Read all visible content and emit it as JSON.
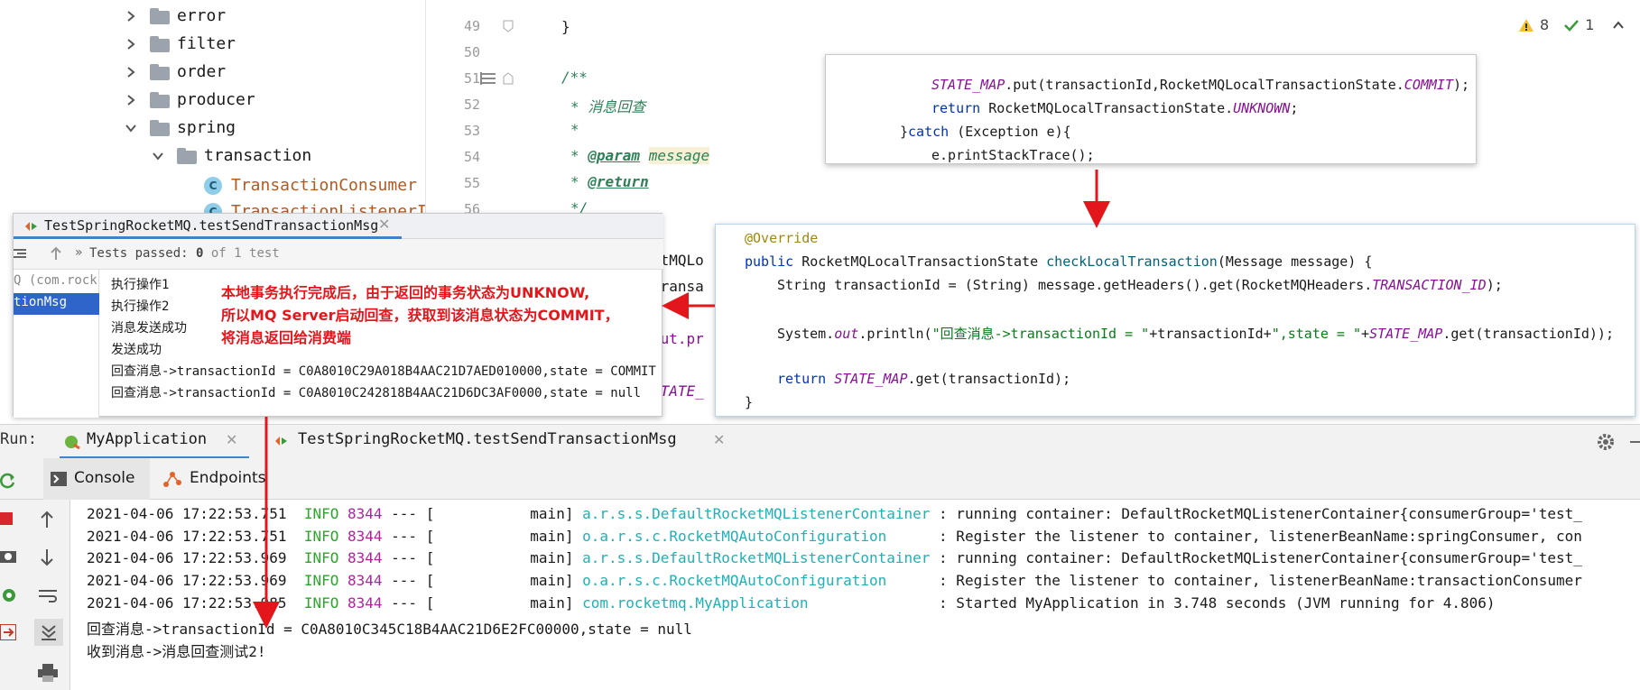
{
  "project_tree": {
    "items": [
      {
        "label": "error",
        "kind": "folder",
        "expanded": false
      },
      {
        "label": "filter",
        "kind": "folder",
        "expanded": false
      },
      {
        "label": "order",
        "kind": "folder",
        "expanded": false
      },
      {
        "label": "producer",
        "kind": "folder",
        "expanded": false
      },
      {
        "label": "spring",
        "kind": "folder",
        "expanded": true
      },
      {
        "label": "transaction",
        "kind": "folder",
        "expanded": true
      },
      {
        "label": "TransactionConsumer",
        "kind": "class"
      },
      {
        "label": "TransactionListenerI",
        "kind": "class"
      }
    ]
  },
  "editor": {
    "line_numbers": [
      "49",
      "50",
      "51",
      "52",
      "53",
      "54",
      "55",
      "56"
    ],
    "lines": {
      "l49": "}",
      "l51": "/**",
      "l52_star": "* ",
      "l52_text": "消息回查",
      "l53": "*",
      "l54_star": "* ",
      "l54_tag": "@param",
      "l54_param": "message",
      "l55_star": "* ",
      "l55_tag": "@return",
      "l56": "*/"
    },
    "peek_lines": [
      "etMQLo",
      "transa",
      "out.pr",
      "STATE_"
    ],
    "inspections": {
      "warnings": "8",
      "ok": "1"
    }
  },
  "popup_top": {
    "line1_const": "STATE_MAP",
    "line1_rest": ".put(transactionId,RocketMQLocalTransactionState.",
    "line1_commit": "COMMIT",
    "line1_end": ");",
    "line2_kw": "return",
    "line2_rest": " RocketMQLocalTransactionState.",
    "line2_unknown": "UNKNOWN",
    "line2_end": ";",
    "line3_open": "}",
    "line3_kw": "catch",
    "line3_rest": " (Exception e){",
    "line4": "e.printStackTrace();"
  },
  "popup_method": {
    "annotation": "@Override",
    "sig_kw": "public",
    "sig_type": " RocketMQLocalTransactionState ",
    "sig_name": "checkLocalTransaction",
    "sig_rest": "(Message message) {",
    "line2_pre": "String transactionId = (String) message.getHeaders().get(RocketMQHeaders.",
    "line2_const": "TRANSACTION_ID",
    "line2_end": ");",
    "line3_pre": "System.",
    "line3_out": "out",
    "line3_mid": ".println(",
    "line3_str1": "\"回查消息->transactionId = \"",
    "line3_mid2": "+transactionId+",
    "line3_str2": "\",state = \"",
    "line3_plus": "+",
    "line3_const": "STATE_MAP",
    "line3_end": ".get(transactionId));",
    "line4_kw": "return",
    "line4_const": "STATE_MAP",
    "line4_end": ".get(transactionId);",
    "close": "}"
  },
  "test_popup": {
    "tab_title": "TestSpringRocketMQ.testSendTransactionMsg",
    "tests_passed_label": "Tests passed: ",
    "tests_passed_count": "0",
    "tests_passed_suffix": " of 1 test",
    "left_items": [
      "Q (com.rock",
      "tionMsg"
    ],
    "output": [
      "执行操作1",
      "执行操作2",
      "消息发送成功",
      "发送成功",
      "回查消息->transactionId = C0A8010C29A018B4AAC21D7AED010000,state = COMMIT",
      "回查消息->transactionId = C0A8010C242818B4AAC21D6DC3AF0000,state = null"
    ]
  },
  "annotation": {
    "lines": [
      "本地事务执行完成后，由于返回的事务状态为UNKNOW,",
      "所以MQ Server启动回查，获取到该消息状态为COMMIT，",
      "将消息返回给消费端"
    ],
    "color": "#e3161b"
  },
  "run_panel": {
    "label": "Run:",
    "tabs": [
      {
        "label": "MyApplication",
        "active": true
      },
      {
        "label": "TestSpringRocketMQ.testSendTransactionMsg",
        "active": false
      }
    ],
    "subtabs": [
      "Console",
      "Endpoints"
    ],
    "log": [
      {
        "ts": "2021-04-06 17:22:53.751",
        "level": "INFO",
        "pid": "8344",
        "sep": " --- [",
        "thread": "           main]",
        "logger": "a.r.s.s.DefaultRocketMQListenerContainer",
        "msg": " : running container: DefaultRocketMQListenerContainer{consumerGroup='test_"
      },
      {
        "ts": "2021-04-06 17:22:53.751",
        "level": "INFO",
        "pid": "8344",
        "sep": " --- [",
        "thread": "           main]",
        "logger": "o.a.r.s.c.RocketMQAutoConfiguration     ",
        "msg": " : Register the listener to container, listenerBeanName:springConsumer, con"
      },
      {
        "ts": "2021-04-06 17:22:53.969",
        "level": "INFO",
        "pid": "8344",
        "sep": " --- [",
        "thread": "           main]",
        "logger": "a.r.s.s.DefaultRocketMQListenerContainer",
        "msg": " : running container: DefaultRocketMQListenerContainer{consumerGroup='test_"
      },
      {
        "ts": "2021-04-06 17:22:53.969",
        "level": "INFO",
        "pid": "8344",
        "sep": " --- [",
        "thread": "           main]",
        "logger": "o.a.r.s.c.RocketMQAutoConfiguration     ",
        "msg": " : Register the listener to container, listenerBeanName:transactionConsumer"
      },
      {
        "ts": "2021-04-06 17:22:53.985",
        "level": "INFO",
        "pid": "8344",
        "sep": " --- [",
        "thread": "           main]",
        "logger": "com.rocketmq.MyApplication              ",
        "msg": " : Started MyApplication in 3.748 seconds (JVM running for 4.806)"
      }
    ],
    "plain": [
      "回查消息->transactionId = C0A8010C345C18B4AAC21D6E2FC00000,state = null",
      "收到消息->消息回查测试2!"
    ]
  },
  "colors": {
    "info": "#2aa62a",
    "pid": "#b0239f",
    "logger": "#1fb1b5",
    "comment": "#2f7f57",
    "keyword": "#0033b3",
    "constant": "#871094",
    "arrow": "#e3161b"
  }
}
